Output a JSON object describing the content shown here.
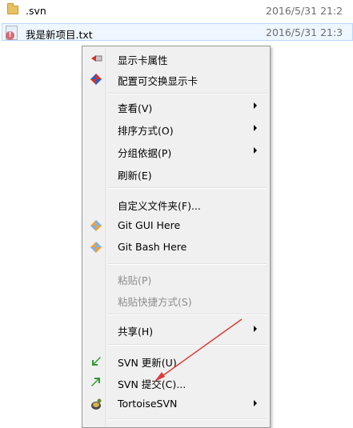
{
  "files": [
    {
      "name": ".svn",
      "date": "2016/5/31 21:2"
    },
    {
      "name": "我是新项目.txt",
      "date": "2016/5/31 21:3"
    }
  ],
  "menu": {
    "items": {
      "display_props": "显示卡属性",
      "switchable_display": "配置可交换显示卡",
      "view": "查看(V)",
      "sort_by": "排序方式(O)",
      "group_by": "分组依据(P)",
      "refresh": "刷新(E)",
      "customize_folder": "自定义文件夹(F)...",
      "git_gui": "Git GUI Here",
      "git_bash": "Git Bash Here",
      "paste": "粘贴(P)",
      "paste_shortcut": "粘贴快捷方式(S)",
      "share": "共享(H)",
      "svn_update": "SVN 更新(U)",
      "svn_commit": "SVN 提交(C)...",
      "tortoise": "TortoiseSVN"
    }
  },
  "icons": {
    "display": "display-adapter-icon",
    "switchable": "switchable-graphics-icon",
    "git": "git-icon",
    "svn_update": "svn-update-icon",
    "svn_commit": "svn-commit-icon",
    "tortoise": "tortoisesvn-icon"
  },
  "colors": {
    "annotation_arrow": "#e03a36",
    "menu_bg": "#f0f0f0",
    "disabled_text": "#8d8d8d"
  }
}
